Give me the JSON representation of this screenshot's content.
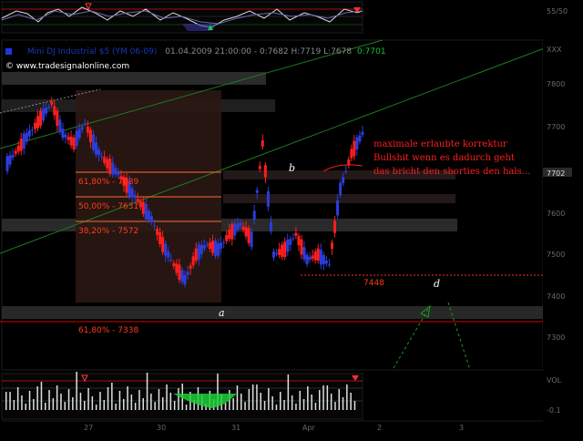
{
  "chart": {
    "instrument": "Mini DJ Industrial $5 (YM 06-09)",
    "datetime": "01.04.2009 21:00:00 - 0:7682 H:7719 L:7678",
    "last": "0:7701",
    "website": "© www.tradesignalonline.com",
    "wave_labels": [
      "a",
      "b",
      "d"
    ],
    "fib_levels": [
      "61,80% - 7689",
      "50,00% - 7631",
      "38,20% - 7572",
      "61,80% - 7338"
    ],
    "level_label": "7448",
    "note_lines": [
      "maximale erlaubte korrektur",
      "Bullshit wenn es dadurch geht",
      "das bricht den shorties den hals..."
    ],
    "price_axis": [
      "7800",
      "7700",
      "7600",
      "7500",
      "7400",
      "7300"
    ],
    "price_marker": "7702",
    "top_panel_axis": [
      "55/50",
      "XXX"
    ],
    "bottom_panel_axis": [
      "VOL",
      "-0.1"
    ],
    "x_axis": [
      "27",
      "30",
      "31",
      "Apr",
      "2",
      "3"
    ]
  },
  "colors": {
    "background": "#000000",
    "up_bar": "#2b3ddc",
    "down_bar": "#ff1e1e",
    "fib_line": "#ff6a2e",
    "trend_line": "#1f7a1f",
    "support_line": "#d40000"
  },
  "chart_data": {
    "type": "candlestick",
    "series": [
      {
        "name": "Mini DJ Industrial $5 (YM 06-09)",
        "values": [
          7640,
          7670,
          7700,
          7730,
          7760,
          7700,
          7680,
          7720,
          7670,
          7640,
          7620,
          7590,
          7560,
          7530,
          7480,
          7440,
          7410,
          7460,
          7480,
          7470,
          7500,
          7520,
          7490,
          7680,
          7460,
          7470,
          7500,
          7450,
          7460,
          7440,
          7590,
          7660,
          7700
        ]
      }
    ],
    "annotations": [
      "61,80% - 7689",
      "50,00% - 7631",
      "38,20% - 7572",
      "61,80% - 7338",
      "7448"
    ]
  }
}
